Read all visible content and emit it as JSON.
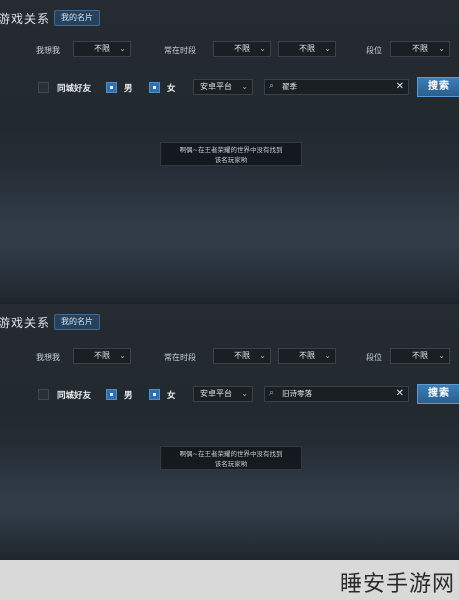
{
  "panels": [
    {
      "title": "游戏关系",
      "my_card_label": "我的名片",
      "filters": {
        "want_me_label": "我想我",
        "want_me_value": "不限",
        "online_time_label": "常在时段",
        "online_time_value_1": "不限",
        "online_time_value_2": "不限",
        "rank_label": "段位",
        "rank_value": "不限"
      },
      "checkboxes": {
        "same_city_label": "同城好友",
        "male_label": "男",
        "female_label": "女"
      },
      "platform_value": "安卓平台",
      "search_value": "翟季",
      "search_button": "搜索",
      "toast_line1": "啊偶~在王者荣耀的世界中没有找到",
      "toast_line2": "该名玩家哟"
    },
    {
      "title": "游戏关系",
      "my_card_label": "我的名片",
      "filters": {
        "want_me_label": "我想我",
        "want_me_value": "不限",
        "online_time_label": "常在时段",
        "online_time_value_1": "不限",
        "online_time_value_2": "不限",
        "rank_label": "段位",
        "rank_value": "不限"
      },
      "checkboxes": {
        "same_city_label": "同城好友",
        "male_label": "男",
        "female_label": "女"
      },
      "platform_value": "安卓平台",
      "search_value": "旧诗零落",
      "search_button": "搜索",
      "toast_line1": "啊偶~在王者荣耀的世界中没有找到",
      "toast_line2": "该名玩家哟"
    }
  ],
  "watermark": "睡安手游网",
  "icons": {
    "caret": "chevron-down-icon",
    "search": "search-icon",
    "clear": "close-icon"
  }
}
